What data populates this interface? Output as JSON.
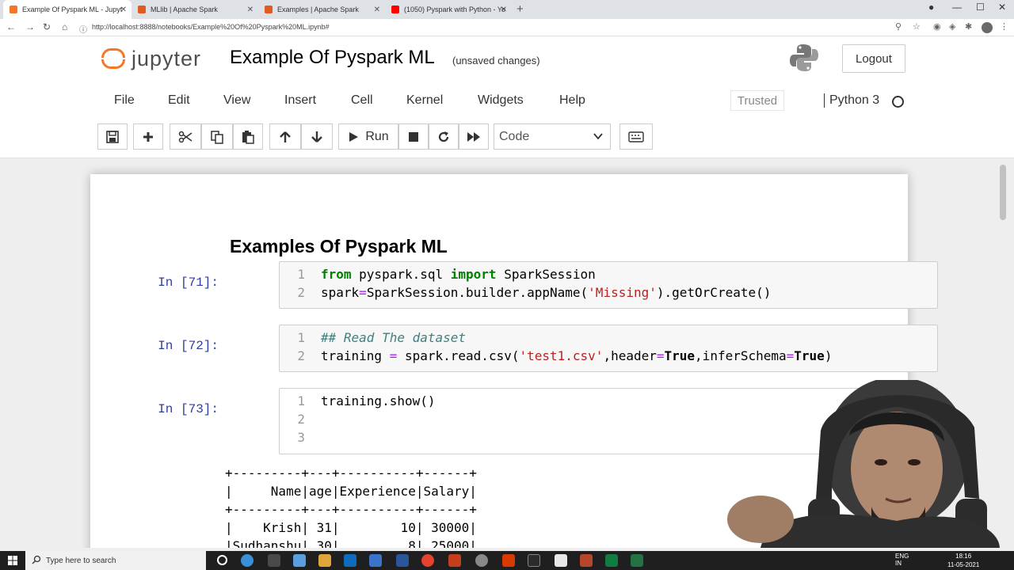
{
  "browser": {
    "tabs": [
      {
        "title": "Example Of Pyspark ML - Jupyt",
        "active": true,
        "favicon_color": "#f37726"
      },
      {
        "title": "MLlib | Apache Spark",
        "active": false,
        "favicon_color": "#e25a1c"
      },
      {
        "title": "Examples | Apache Spark",
        "active": false,
        "favicon_color": "#e25a1c"
      },
      {
        "title": "(1050) Pyspark with Python - Yo",
        "active": false,
        "favicon_color": "#ff0000"
      }
    ],
    "url": "http://localhost:8888/notebooks/Example%20Of%20Pyspark%20ML.ipynb#"
  },
  "jupyter": {
    "logo_text": "jupyter",
    "notebook_title": "Example Of Pyspark ML",
    "save_status": "(unsaved changes)",
    "logout_label": "Logout",
    "menu": [
      "File",
      "Edit",
      "View",
      "Insert",
      "Cell",
      "Kernel",
      "Widgets",
      "Help"
    ],
    "trusted_label": "Trusted",
    "kernel_name": "Python 3",
    "run_label": "Run",
    "cell_type": "Code"
  },
  "notebook": {
    "heading": "Examples Of Pyspark ML",
    "cells": [
      {
        "prompt": "In [71]:",
        "lines": [
          "from pyspark.sql import SparkSession",
          "spark=SparkSession.builder.appName('Missing').getOrCreate()"
        ]
      },
      {
        "prompt": "In [72]:",
        "lines": [
          "## Read The dataset",
          "training = spark.read.csv('test1.csv',header=True,inferSchema=True)"
        ]
      },
      {
        "prompt": "In [73]:",
        "lines": [
          "training.show()",
          "",
          ""
        ]
      }
    ],
    "output_lines": [
      "+---------+---+----------+------+",
      "|     Name|age|Experience|Salary|",
      "+---------+---+----------+------+",
      "|    Krish| 31|        10| 30000|",
      "|Sudhanshu| 30|         8| 25000|"
    ]
  },
  "taskbar": {
    "search_placeholder": "Type here to search",
    "lang": "ENG",
    "region": "IN",
    "time": "18:16",
    "date": "11-05-2021"
  },
  "colors": {
    "accent": "#f37726",
    "prompt": "#303f9f",
    "keyword": "#008000",
    "string": "#ba2121",
    "comment": "#408080"
  }
}
